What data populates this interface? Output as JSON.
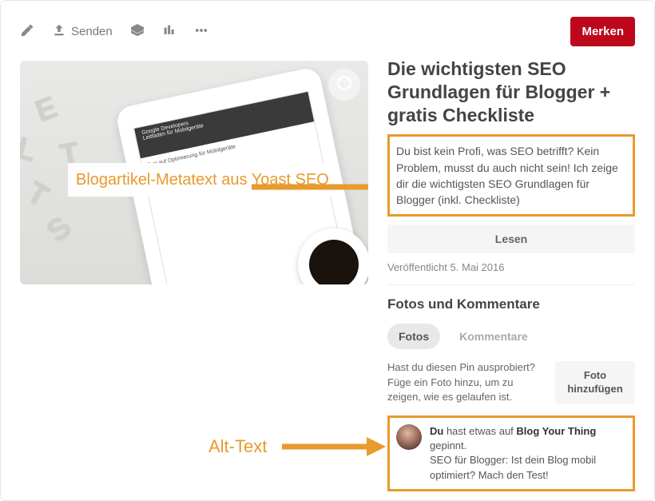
{
  "toolbar": {
    "send_label": "Senden",
    "save_label": "Merken"
  },
  "annotations": {
    "meta_label": "Blogartikel-Metatext aus Yoast SEO",
    "alt_label": "Alt-Text"
  },
  "pin": {
    "title": "Die wichtigsten SEO Grundlagen für Blogger + gratis Checkliste",
    "description": "Du bist kein Profi, was SEO betrifft? Kein Problem, musst du auch nicht sein! Ich zeige dir die wichtigsten SEO Grundlagen für Blogger (inkl. Checkliste)",
    "read_label": "Lesen",
    "published": "Veröffentlicht 5. Mai 2016"
  },
  "comments": {
    "section_title": "Fotos und Kommentare",
    "tab_photos": "Fotos",
    "tab_comments": "Kommentare",
    "photo_prompt": "Hast du diesen Pin ausprobiert? Füge ein Foto hinzu, um zu zeigen, wie es gelaufen ist.",
    "add_photo_label": "Foto hinzufügen",
    "pinned_you": "Du",
    "pinned_mid": " hast etwas auf ",
    "pinned_site": "Blog Your Thing",
    "pinned_end": " gepinnt.",
    "alt_text": "SEO für Blogger: Ist dein Blog mobil optimiert? Mach den Test!"
  }
}
